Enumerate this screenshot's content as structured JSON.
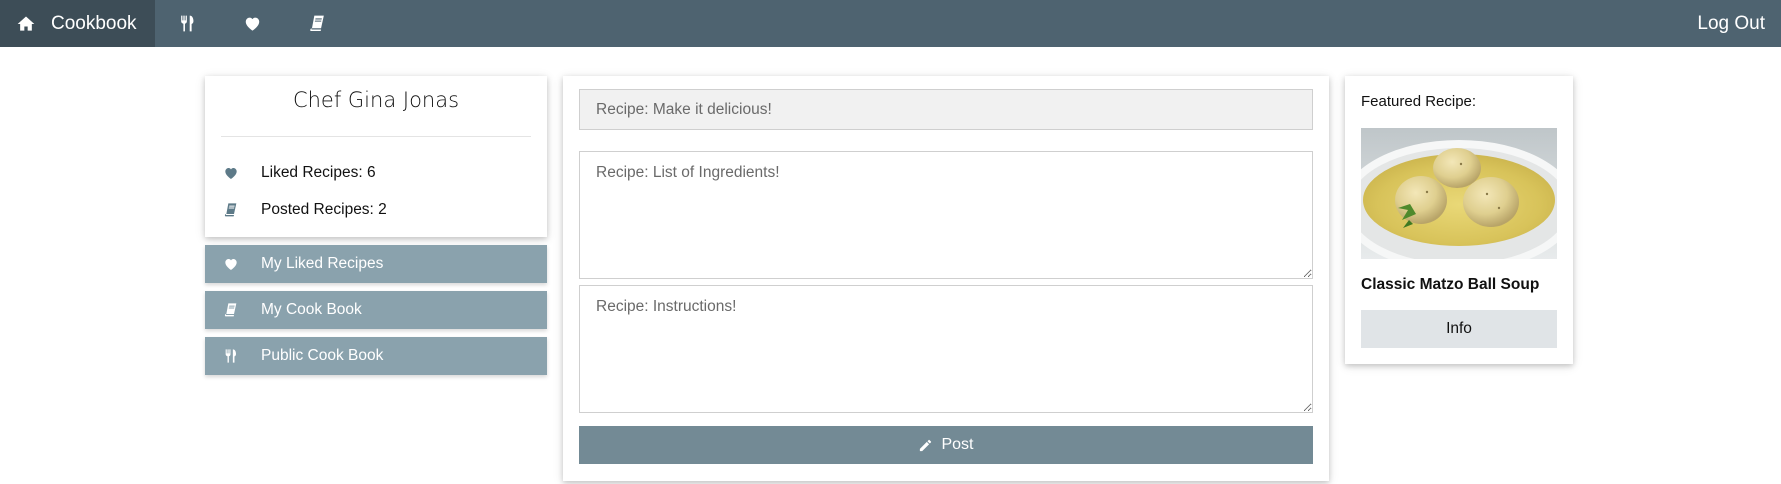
{
  "nav": {
    "brand": "Cookbook",
    "brand_icon": "home-icon",
    "icons": [
      "utensils-icon",
      "heart-icon",
      "book-icon"
    ],
    "logout": "Log Out",
    "bar_color": "#4e6370",
    "active_color": "#3d4d57"
  },
  "profile": {
    "name": "Chef Gina Jonas",
    "liked": "Liked Recipes: 6",
    "posted": "Posted Recipes: 2",
    "icon_color": "#5d7a88"
  },
  "sidebar": {
    "items": [
      {
        "label": "My Liked Recipes",
        "icon": "heart-icon"
      },
      {
        "label": "My Cook Book",
        "icon": "book-icon"
      },
      {
        "label": "Public Cook Book",
        "icon": "utensils-icon"
      }
    ],
    "button_color": "#8aa2ad"
  },
  "form": {
    "title_placeholder": "Recipe: Make it delicious!",
    "ingredients_placeholder": "Recipe: List of Ingredients!",
    "instructions_placeholder": "Recipe: Instructions!",
    "post_label": "Post",
    "post_icon": "pencil-icon",
    "post_color": "#738a95"
  },
  "featured": {
    "label": "Featured Recipe:",
    "image": "matzo-ball-soup-photo",
    "name": "Classic Matzo Ball Soup",
    "info_label": "Info"
  }
}
